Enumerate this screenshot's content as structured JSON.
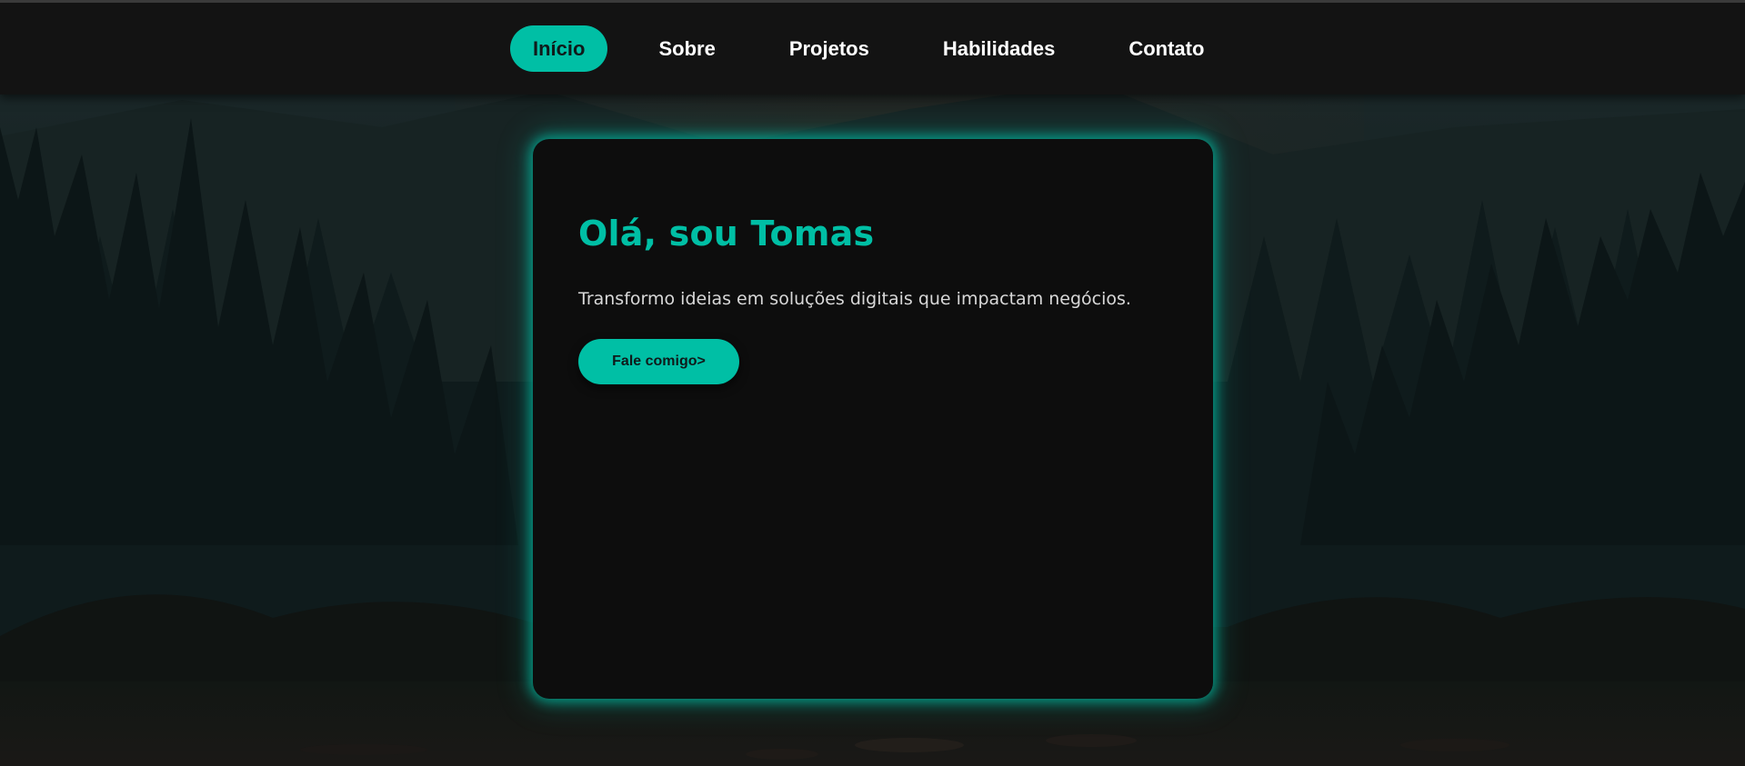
{
  "nav": {
    "items": [
      {
        "label": "Início",
        "active": true
      },
      {
        "label": "Sobre",
        "active": false
      },
      {
        "label": "Projetos",
        "active": false
      },
      {
        "label": "Habilidades",
        "active": false
      },
      {
        "label": "Contato",
        "active": false
      }
    ]
  },
  "hero": {
    "title": "Olá, sou Tomas",
    "subtitle": "Transformo ideias em soluções digitais que impactam negócios.",
    "cta_label": "Fale comigo>"
  },
  "colors": {
    "accent": "#00bfa5",
    "navbar": "#131313",
    "card": "#0d0d0d",
    "text": "#ffffff"
  }
}
